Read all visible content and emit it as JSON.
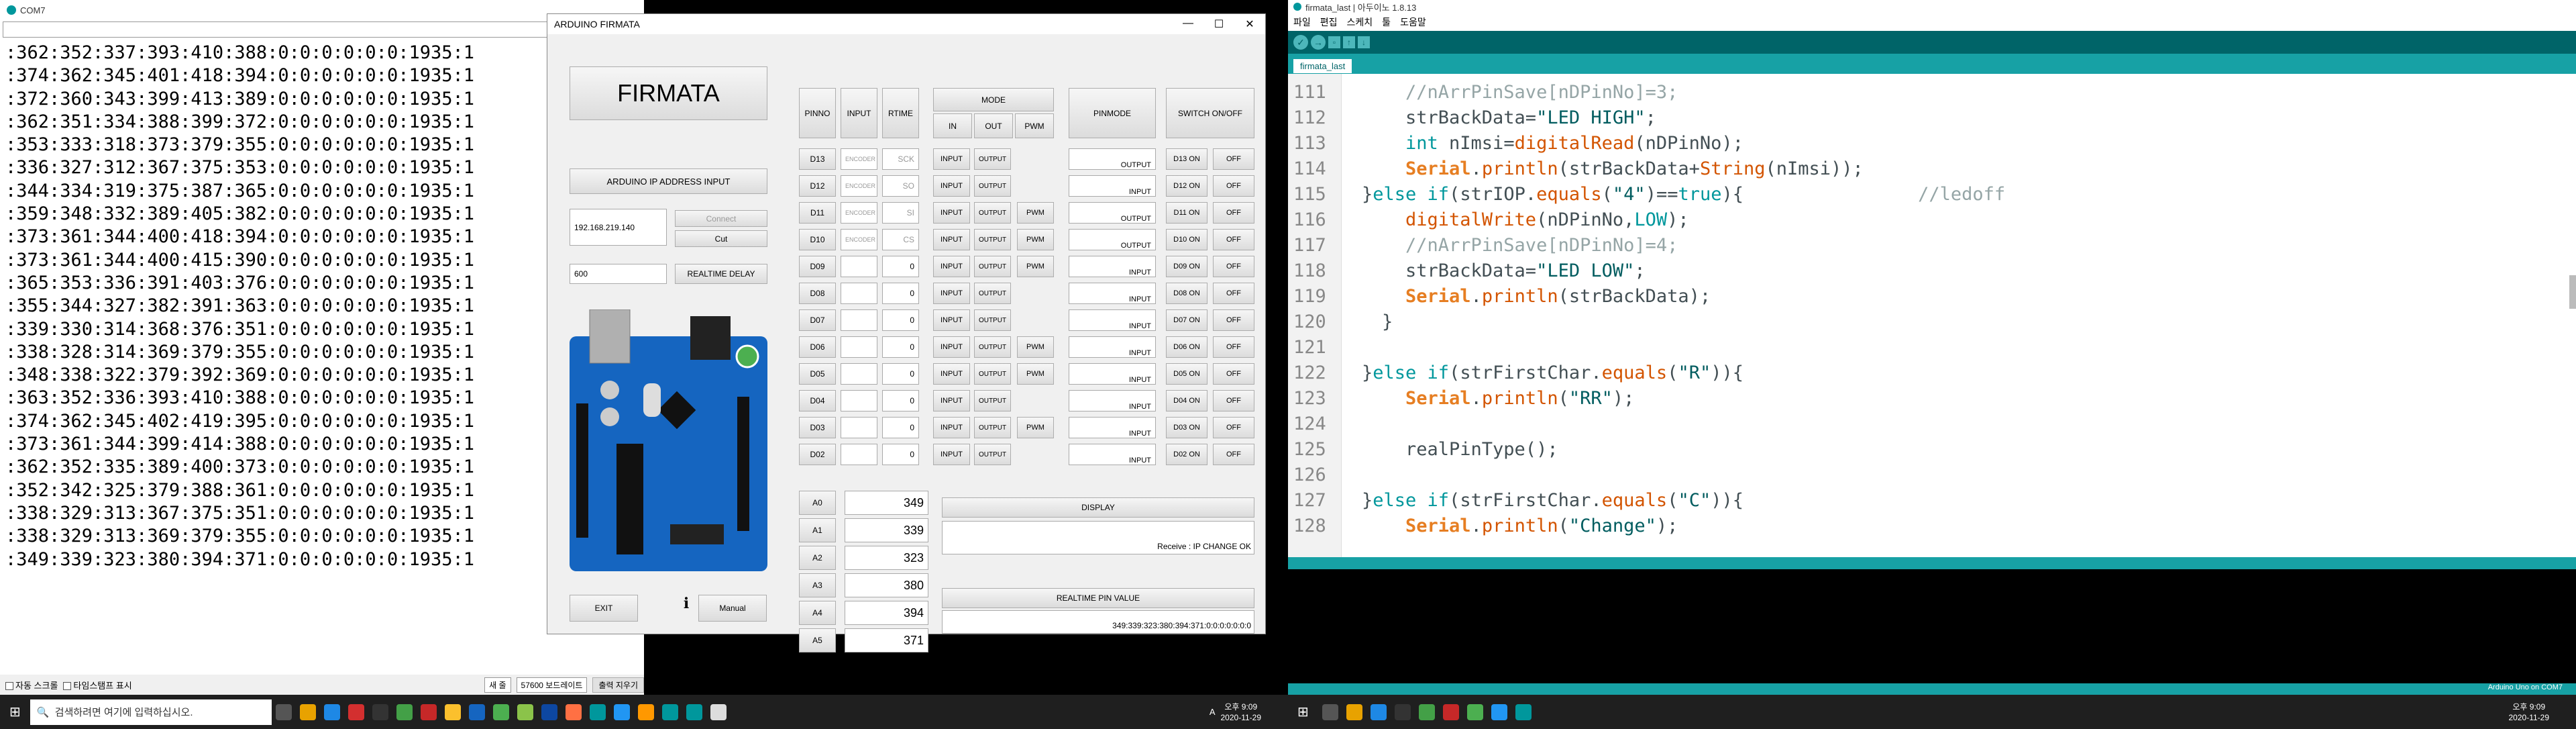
{
  "serial": {
    "title": "COM7",
    "lines": [
      ":362:352:337:393:410:388:0:0:0:0:0:0:1935:1",
      ":374:362:345:401:418:394:0:0:0:0:0:0:1935:1",
      ":372:360:343:399:413:389:0:0:0:0:0:0:1935:1",
      ":362:351:334:388:399:372:0:0:0:0:0:0:1935:1",
      ":353:333:318:373:379:355:0:0:0:0:0:0:1935:1",
      ":336:327:312:367:375:353:0:0:0:0:0:0:1935:1",
      ":344:334:319:375:387:365:0:0:0:0:0:0:1935:1",
      ":359:348:332:389:405:382:0:0:0:0:0:0:1935:1",
      ":373:361:344:400:418:394:0:0:0:0:0:0:1935:1",
      ":373:361:344:400:415:390:0:0:0:0:0:0:1935:1",
      ":365:353:336:391:403:376:0:0:0:0:0:0:1935:1",
      ":355:344:327:382:391:363:0:0:0:0:0:0:1935:1",
      ":339:330:314:368:376:351:0:0:0:0:0:0:1935:1",
      ":338:328:314:369:379:355:0:0:0:0:0:0:1935:1",
      ":348:338:322:379:392:369:0:0:0:0:0:0:1935:1",
      ":363:352:336:393:410:388:0:0:0:0:0:0:1935:1",
      ":374:362:345:402:419:395:0:0:0:0:0:0:1935:1",
      ":373:361:344:399:414:388:0:0:0:0:0:0:1935:1",
      ":362:352:335:389:400:373:0:0:0:0:0:0:1935:1",
      ":352:342:325:379:388:361:0:0:0:0:0:0:1935:1",
      ":338:329:313:367:375:351:0:0:0:0:0:0:1935:1",
      ":338:329:313:369:379:355:0:0:0:0:0:0:1935:1",
      ":349:339:323:380:394:371:0:0:0:0:0:0:1935:1"
    ],
    "autoscroll": "자동 스크롤",
    "timestamp": "타임스탬프 표시",
    "line_ending": "새 줄",
    "baud": "57600 보드레이트",
    "clear": "출력 지우기"
  },
  "firmata": {
    "window_title": "ARDUINO FIRMATA",
    "logo": "FIRMATA",
    "ip_button": "ARDUINO IP ADDRESS INPUT",
    "ip_value": "192.168.219.140",
    "connect": "Connect",
    "cut": "Cut",
    "delay_value": "600",
    "delay_button": "REALTIME DELAY",
    "headers": {
      "pinno": "PINNO",
      "input": "INPUT",
      "rtime": "RTIME",
      "mode": "MODE",
      "in": "IN",
      "out": "OUT",
      "pwm": "PWM",
      "pinmode": "PINMODE",
      "switch": "SWITCH ON/OFF"
    },
    "digital_pins": [
      {
        "pin": "D13",
        "val": "ENCODER",
        "rt": "SCK",
        "pwm": "",
        "mode": "OUTPUT",
        "on": "D13 ON"
      },
      {
        "pin": "D12",
        "val": "ENCODER",
        "rt": "SO",
        "pwm": "",
        "mode": "INPUT",
        "on": "D12 ON"
      },
      {
        "pin": "D11",
        "val": "ENCODER",
        "rt": "SI",
        "pwm": "PWM",
        "mode": "OUTPUT",
        "on": "D11 ON"
      },
      {
        "pin": "D10",
        "val": "ENCODER",
        "rt": "CS",
        "pwm": "PWM",
        "mode": "OUTPUT",
        "on": "D10 ON"
      },
      {
        "pin": "D09",
        "val": "",
        "rt": "0",
        "pwm": "PWM",
        "mode": "INPUT",
        "on": "D09 ON"
      },
      {
        "pin": "D08",
        "val": "",
        "rt": "0",
        "pwm": "",
        "mode": "INPUT",
        "on": "D08 ON"
      },
      {
        "pin": "D07",
        "val": "",
        "rt": "0",
        "pwm": "",
        "mode": "INPUT",
        "on": "D07 ON"
      },
      {
        "pin": "D06",
        "val": "",
        "rt": "0",
        "pwm": "PWM",
        "mode": "INPUT",
        "on": "D06 ON"
      },
      {
        "pin": "D05",
        "val": "",
        "rt": "0",
        "pwm": "PWM",
        "mode": "INPUT",
        "on": "D05 ON"
      },
      {
        "pin": "D04",
        "val": "",
        "rt": "0",
        "pwm": "",
        "mode": "INPUT",
        "on": "D04 ON"
      },
      {
        "pin": "D03",
        "val": "",
        "rt": "0",
        "pwm": "PWM",
        "mode": "INPUT",
        "on": "D03 ON"
      },
      {
        "pin": "D02",
        "val": "",
        "rt": "0",
        "pwm": "",
        "mode": "INPUT",
        "on": "D02 ON"
      }
    ],
    "in_label": "INPUT",
    "out_label": "OUTPUT",
    "off_label": "OFF",
    "analog": [
      {
        "pin": "A0",
        "val": "349"
      },
      {
        "pin": "A1",
        "val": "339"
      },
      {
        "pin": "A2",
        "val": "323"
      },
      {
        "pin": "A3",
        "val": "380"
      },
      {
        "pin": "A4",
        "val": "394"
      },
      {
        "pin": "A5",
        "val": "371"
      }
    ],
    "display": "DISPLAY",
    "receive": "Receive : IP CHANGE OK",
    "realtime_label": "REALTIME PIN VALUE",
    "realtime_value": "349:339:323:380:394:371:0:0:0:0:0:0:0",
    "exit": "EXIT",
    "manual": "Manual"
  },
  "ide": {
    "title": "firmata_last | 아두이노 1.8.13",
    "menu": [
      "파일",
      "편집",
      "스케치",
      "툴",
      "도움말"
    ],
    "tab": "firmata_last",
    "status": "Arduino Uno on COM7"
  },
  "taskbar": {
    "search": "검색하려면 여기에 입력하십시오.",
    "time": "오후 9:09",
    "date": "2020-11-29",
    "time2": "오후 9:09",
    "date2": "2020-11-29",
    "ime": "A"
  }
}
